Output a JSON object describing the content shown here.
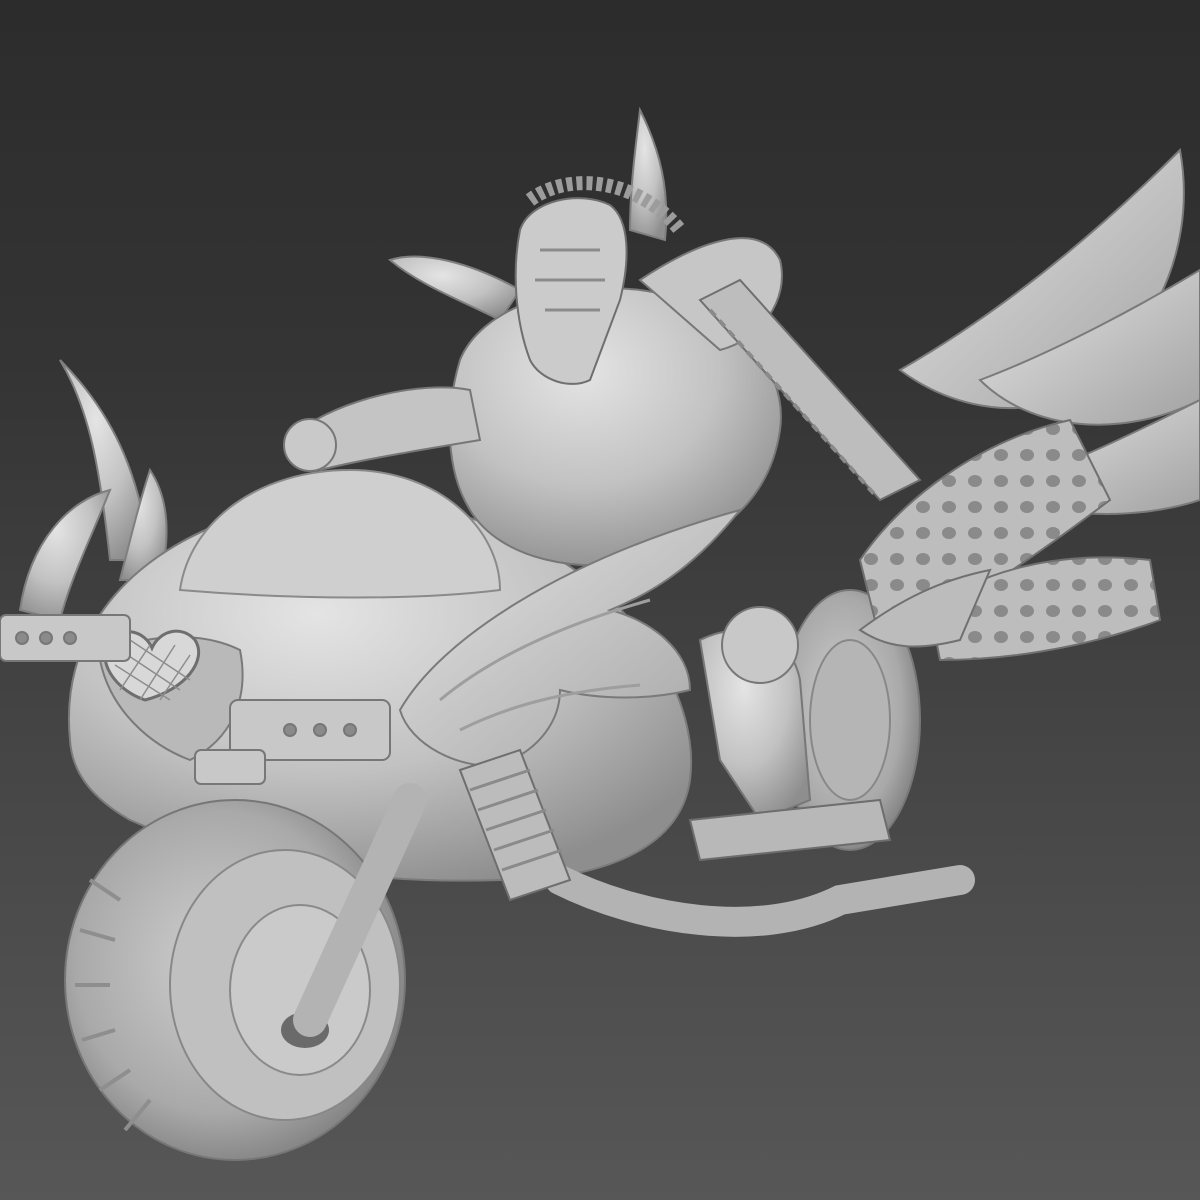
{
  "viewport": {
    "background_top": "#2c2c2c",
    "background_bottom": "#575757",
    "model_color": "#c4c4c4",
    "model_shadow": "#8a8a8a",
    "model_highlight": "#e2e2e2"
  },
  "scene": {
    "subject": "3d-model-rider-on-winged-bike",
    "icons": [
      "wing-icon",
      "heart-icon",
      "sword-icon",
      "wheel-icon"
    ]
  }
}
